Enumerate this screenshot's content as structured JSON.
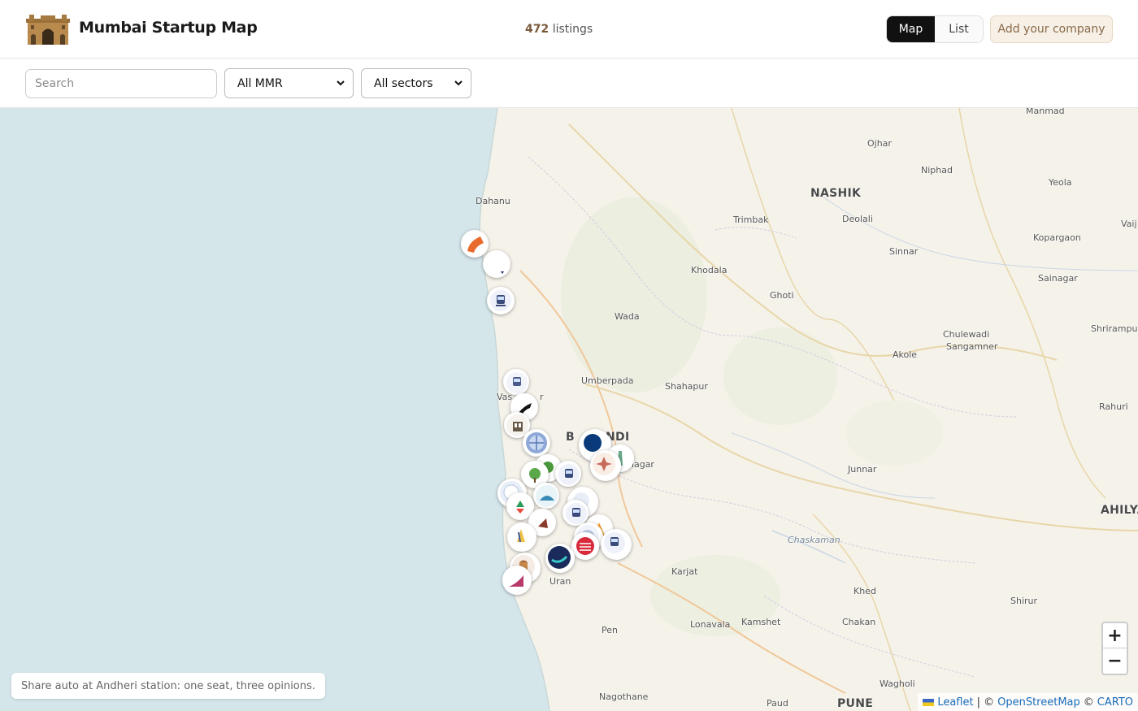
{
  "header": {
    "brand": "Mumbai Startup Map",
    "listings_count": "472",
    "listings_label": "listings",
    "view_map": "Map",
    "view_list": "List",
    "add_company": "Add your company"
  },
  "filters": {
    "search_placeholder": "Search",
    "region": "All MMR",
    "sector": "All sectors"
  },
  "map": {
    "places": {
      "manmad": "Manmad",
      "ojhar": "Ojhar",
      "niphad": "Niphad",
      "nashik": "NASHIK",
      "yeola": "Yeola",
      "vaij": "Vaij",
      "dahanu": "Dahanu",
      "trimbak": "Trimbak",
      "deolali": "Deolali",
      "kopargaon": "Kopargaon",
      "sinnar": "Sinnar",
      "khodala": "Khodala",
      "sainagar": "Sainagar",
      "ghoti": "Ghoti",
      "wada": "Wada",
      "chulewadi": "Chulewadi",
      "sangamner": "Sangamner",
      "shrirampur": "Shrirampur",
      "akole": "Akole",
      "umberpada": "Umberpada",
      "shahapur": "Shahapur",
      "vasai": "Vas",
      "vasai_tail": "r",
      "rahuri": "Rahuri",
      "bhiwandi_a": "B",
      "bhiwandi_b": "NDI",
      "nagar": "nagar",
      "junnar": "Junnar",
      "ahilya": "AHILYA",
      "chaskaman": "Chaskaman",
      "karjat": "Karjat",
      "uran": "Uran",
      "khed": "Khed",
      "shirur": "Shirur",
      "pen": "Pen",
      "lonavala": "Lonavala",
      "kamshet": "Kamshet",
      "chakan": "Chakan",
      "wagholi": "Wagholi",
      "nagothane": "Nagothane",
      "paud": "Paud",
      "pune": "PUNE"
    },
    "zoom_in": "+",
    "zoom_out": "−",
    "toast": "Share auto at Andheri station: one seat, three opinions.",
    "attribution": {
      "leaflet": "Leaflet",
      "sep1": "| ©",
      "osm": "OpenStreetMap",
      "sep2": "©",
      "carto": "CARTO"
    }
  },
  "colors": {
    "sea": "#d4e6ea",
    "land": "#f5f2ea",
    "accent_brown": "#7a5a3a",
    "map_selected_bg": "#111111"
  }
}
